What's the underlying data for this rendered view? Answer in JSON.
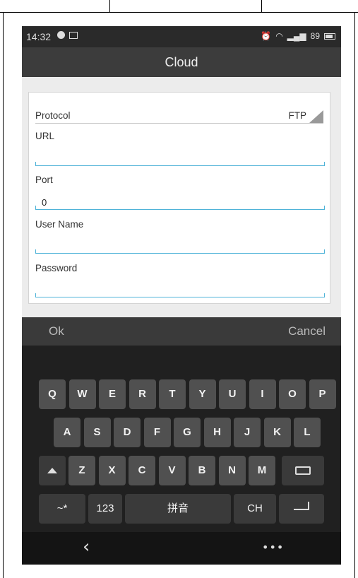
{
  "status_bar": {
    "time": "14:32",
    "battery_level": "89"
  },
  "title": "Cloud",
  "form": {
    "protocol_label": "Protocol",
    "protocol_value": "FTP",
    "url_label": "URL",
    "url_value": "",
    "port_label": "Port",
    "port_value": "0",
    "username_label": "User Name",
    "username_value": "",
    "password_label": "Password",
    "password_value": ""
  },
  "actions": {
    "ok": "Ok",
    "cancel": "Cancel"
  },
  "keyboard": {
    "row1": [
      "Q",
      "W",
      "E",
      "R",
      "T",
      "Y",
      "U",
      "I",
      "O",
      "P"
    ],
    "row2": [
      "A",
      "S",
      "D",
      "F",
      "G",
      "H",
      "J",
      "K",
      "L"
    ],
    "row3": [
      "Z",
      "X",
      "C",
      "V",
      "B",
      "N",
      "M"
    ],
    "symbols_key": "~*",
    "numbers_key": "123",
    "space_key": "拼音",
    "language_key": "CH"
  },
  "colors": {
    "accent_underline": "#4fb3d8",
    "key_bg": "#505050"
  }
}
